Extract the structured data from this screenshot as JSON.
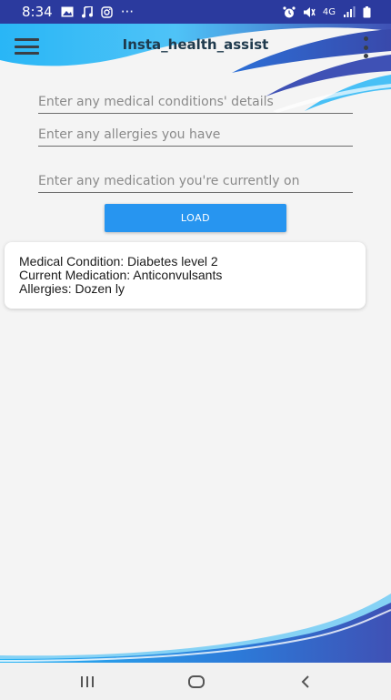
{
  "status_bar": {
    "time": "8:34",
    "more_notifications": "···",
    "network_type": "4G",
    "colors": {
      "background": "#2b3a9e",
      "foreground": "#ffffff"
    },
    "icons": [
      "gallery-icon",
      "music-icon",
      "instagram-icon",
      "alarm-icon",
      "mute-icon",
      "signal-icon",
      "battery-icon"
    ]
  },
  "toolbar": {
    "title": "Insta_health_assist",
    "icons": [
      "hamburger-menu-icon",
      "overflow-menu-icon"
    ]
  },
  "form": {
    "medical_conditions": {
      "placeholder": "Enter any medical conditions' details",
      "value": ""
    },
    "allergies": {
      "placeholder": "Enter any allergies you have",
      "value": ""
    },
    "medication": {
      "placeholder": "Enter any medication you're currently on",
      "value": ""
    },
    "load_label": "LOAD"
  },
  "result": {
    "line1": "Medical Condition: Diabetes level 2",
    "line2": "Current Medication: Anticonvulsants",
    "line3": "Allergies: Dozen ly"
  },
  "navigation_bar": {
    "icons": [
      "recent-apps-icon",
      "home-icon",
      "back-icon"
    ]
  },
  "theme": {
    "accent": "#2795f0",
    "wave_dark": "#3f51b5",
    "wave_light": "#29b6f6",
    "background": "#f4f4f4"
  }
}
